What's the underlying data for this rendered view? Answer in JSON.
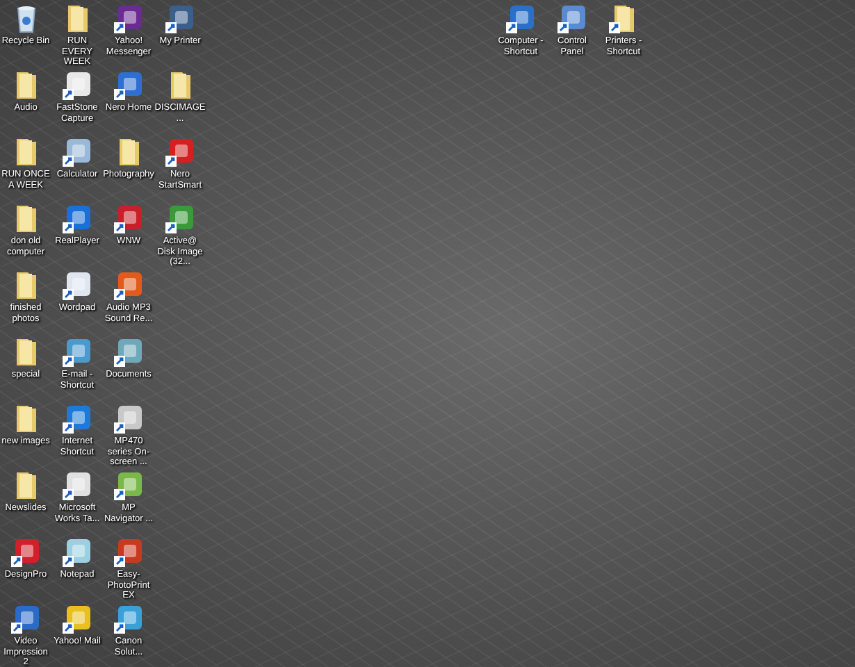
{
  "desktop_icons": [
    {
      "label": "Recycle Bin",
      "kind": "bin",
      "shortcut": false
    },
    {
      "label": "Audio",
      "kind": "folder",
      "shortcut": false
    },
    {
      "label": "RUN ONCE A WEEK",
      "kind": "folder",
      "shortcut": false
    },
    {
      "label": "don old computer",
      "kind": "folder",
      "shortcut": false
    },
    {
      "label": "finished photos",
      "kind": "folder",
      "shortcut": false
    },
    {
      "label": "special",
      "kind": "folder",
      "shortcut": false
    },
    {
      "label": "new images",
      "kind": "folder",
      "shortcut": false
    },
    {
      "label": "Newslides",
      "kind": "folder",
      "shortcut": false
    },
    {
      "label": "DesignPro",
      "kind": "app",
      "color": "#d0202a",
      "shortcut": true
    },
    {
      "label": "Video Impression 2",
      "kind": "app",
      "color": "#2a6ac8",
      "shortcut": true
    },
    {
      "label": "RUN EVERY WEEK",
      "kind": "folder",
      "shortcut": false
    },
    {
      "label": "FastStone Capture",
      "kind": "app",
      "color": "#e8e8e8",
      "shortcut": true
    },
    {
      "label": "Calculator",
      "kind": "app",
      "color": "#9ab8d8",
      "shortcut": true
    },
    {
      "label": "RealPlayer",
      "kind": "app",
      "color": "#1a6fd8",
      "shortcut": true
    },
    {
      "label": "Wordpad",
      "kind": "app",
      "color": "#dfe6f0",
      "shortcut": true
    },
    {
      "label": "E-mail - Shortcut",
      "kind": "app",
      "color": "#4a9ad0",
      "shortcut": true
    },
    {
      "label": "Internet Shortcut",
      "kind": "app",
      "color": "#1e7ad8",
      "shortcut": true
    },
    {
      "label": "Microsoft Works Ta...",
      "kind": "app",
      "color": "#e0e0e0",
      "shortcut": true
    },
    {
      "label": "Notepad",
      "kind": "app",
      "color": "#9ad0e0",
      "shortcut": true
    },
    {
      "label": "Yahoo! Mail",
      "kind": "app",
      "color": "#e8c020",
      "shortcut": true
    },
    {
      "label": "Yahoo! Messenger",
      "kind": "app",
      "color": "#6a2c91",
      "shortcut": true
    },
    {
      "label": "Nero Home",
      "kind": "app",
      "color": "#2f6fd0",
      "shortcut": true
    },
    {
      "label": "Photography",
      "kind": "folder",
      "shortcut": false
    },
    {
      "label": "WNW",
      "kind": "app",
      "color": "#c8202a",
      "shortcut": true
    },
    {
      "label": "Audio MP3 Sound Re...",
      "kind": "app",
      "color": "#e25a1c",
      "shortcut": true
    },
    {
      "label": "Documents",
      "kind": "app",
      "color": "#6fa8b8",
      "shortcut": true
    },
    {
      "label": "MP470 series On-screen ...",
      "kind": "app",
      "color": "#c8c8c8",
      "shortcut": true
    },
    {
      "label": "MP Navigator ...",
      "kind": "app",
      "color": "#7ab84a",
      "shortcut": true
    },
    {
      "label": "Easy-PhotoPrint EX",
      "kind": "app",
      "color": "#c83a20",
      "shortcut": true
    },
    {
      "label": "Canon Solut...",
      "kind": "app",
      "color": "#3aa0d8",
      "shortcut": true
    },
    {
      "label": "My Printer",
      "kind": "app",
      "color": "#3a5f8a",
      "shortcut": true
    },
    {
      "label": "DISCIMAGE...",
      "kind": "folder",
      "shortcut": false
    },
    {
      "label": "Nero StartSmart",
      "kind": "app",
      "color": "#d42020",
      "shortcut": true
    },
    {
      "label": "Active@ Disk Image (32...",
      "kind": "app",
      "color": "#3a9a3a",
      "shortcut": true
    }
  ],
  "top_icons": [
    {
      "label": "Computer - Shortcut",
      "kind": "app",
      "color": "#2a70c8",
      "shortcut": true
    },
    {
      "label": "Control Panel",
      "kind": "app",
      "color": "#5a8ad0",
      "shortcut": true
    },
    {
      "label": "Printers - Shortcut",
      "kind": "folder",
      "shortcut": true
    }
  ]
}
